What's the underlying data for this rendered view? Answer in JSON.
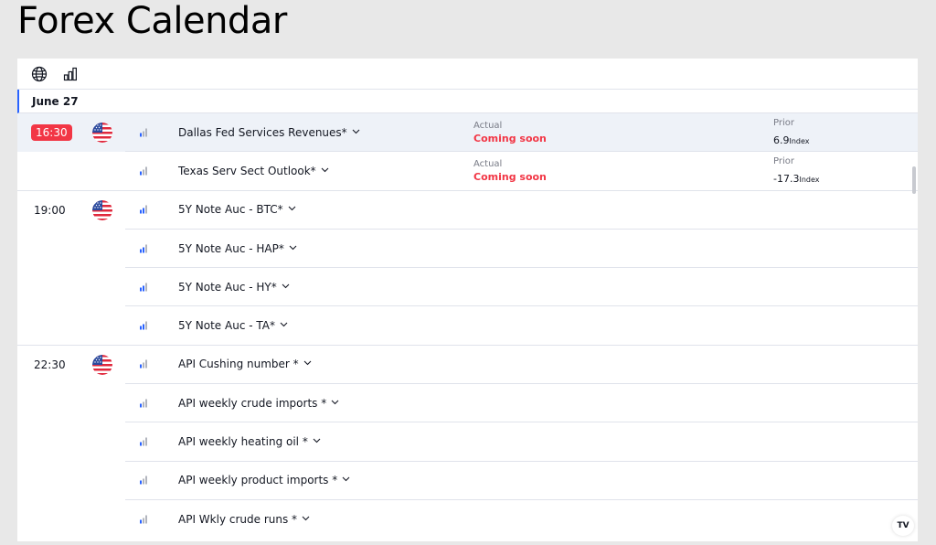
{
  "page": {
    "title": "Forex Calendar"
  },
  "toolbar": {
    "icons": [
      "globe-icon",
      "bar-chart-icon"
    ]
  },
  "calendar": {
    "date": "June 27",
    "colors": {
      "accent": "#2962ff",
      "alert": "#f23645",
      "importance_active": "#2962ff",
      "importance_inactive": "#b2b5be"
    },
    "events": [
      {
        "time": "16:30",
        "time_highlight": true,
        "country_flag": "us-flag-icon",
        "importance": 1,
        "name": "Dallas Fed Services Revenues*",
        "actual_label": "Actual",
        "actual": "Coming soon",
        "prior_label": "Prior",
        "prior": "6.9",
        "prior_unit": "Index"
      },
      {
        "time": "",
        "country_flag": "",
        "importance": 1,
        "name": "Texas Serv Sect Outlook*",
        "actual_label": "Actual",
        "actual": "Coming soon",
        "prior_label": "Prior",
        "prior": "-17.3",
        "prior_unit": "Index"
      },
      {
        "time": "19:00",
        "country_flag": "us-flag-icon",
        "importance": 2,
        "name": "5Y Note Auc - BTC*"
      },
      {
        "time": "",
        "importance": 2,
        "name": "5Y Note Auc - HAP*"
      },
      {
        "time": "",
        "importance": 2,
        "name": "5Y Note Auc - HY*"
      },
      {
        "time": "",
        "importance": 2,
        "name": "5Y Note Auc - TA*"
      },
      {
        "time": "22:30",
        "country_flag": "us-flag-icon",
        "importance": 1,
        "name": "API Cushing number *"
      },
      {
        "time": "",
        "importance": 1,
        "name": "API weekly crude imports *"
      },
      {
        "time": "",
        "importance": 1,
        "name": "API weekly heating oil *"
      },
      {
        "time": "",
        "importance": 1,
        "name": "API weekly product imports *"
      },
      {
        "time": "",
        "importance": 1,
        "name": "API Wkly crude runs *"
      }
    ]
  },
  "branding": {
    "logo": "TV"
  }
}
